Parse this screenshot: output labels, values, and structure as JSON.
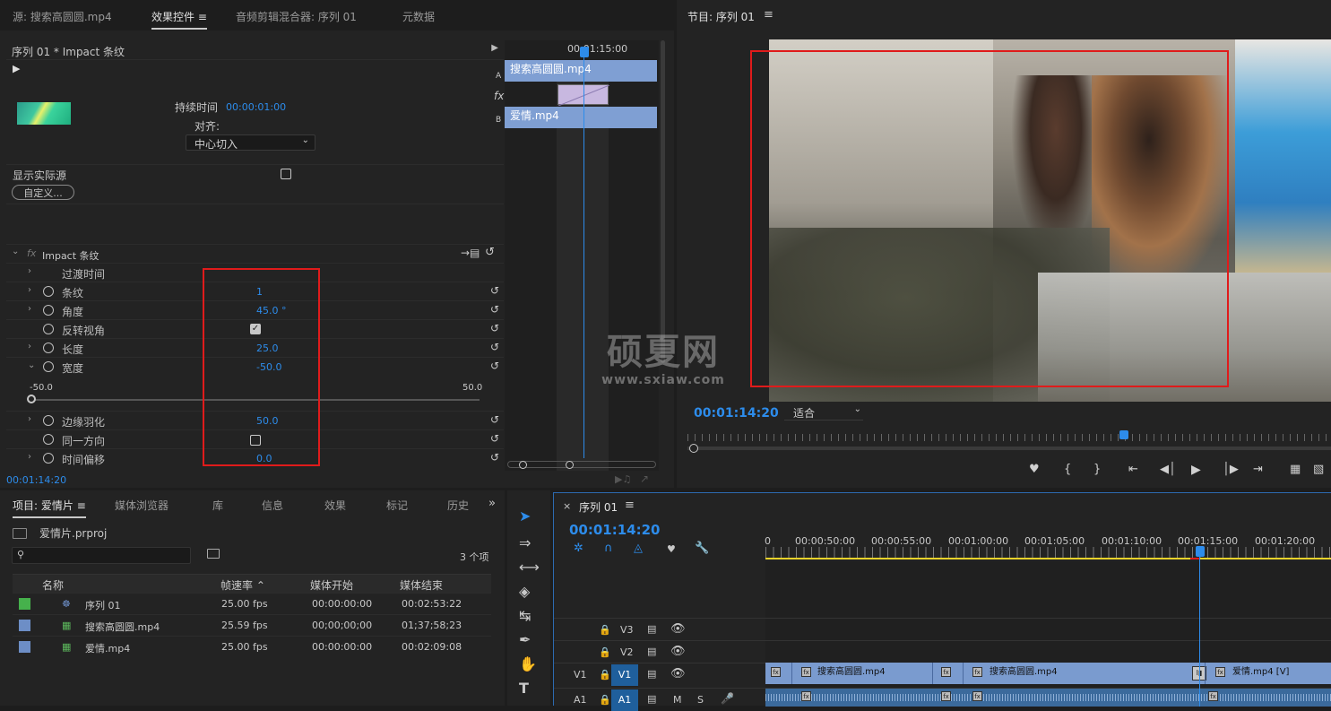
{
  "source_panel": {
    "tabs": [
      "源: 搜索高圆圆.mp4",
      "效果控件",
      "音频剪辑混合器: 序列 01",
      "元数据"
    ],
    "header": "序列 01 * Impact 条纹",
    "duration_label": "持续时间",
    "duration_value": "00:00:01:00",
    "align_label": "对齐:",
    "align_value": "中心切入",
    "show_source_label": "显示实际源",
    "custom_button": "自定义...",
    "effect_name": "Impact 条纹",
    "transition_time_label": "过渡时间",
    "params": [
      {
        "label": "条纹",
        "value": "1"
      },
      {
        "label": "角度",
        "value": "45.0 °"
      },
      {
        "label": "反转视角",
        "value": ""
      },
      {
        "label": "长度",
        "value": "25.0"
      },
      {
        "label": "宽度",
        "value": "-50.0"
      },
      {
        "label": "边缘羽化",
        "value": "50.0"
      },
      {
        "label": "同一方向",
        "value": ""
      },
      {
        "label": "时间偏移",
        "value": "0.0"
      }
    ],
    "slider_min": "-50.0",
    "slider_max": "50.0",
    "timecode": "00:01:14:20",
    "mini_timeline": {
      "time": "00:01:15:00",
      "clip_a": "搜索高圆圆.mp4",
      "clip_b": "爱情.mp4",
      "label_a": "A",
      "label_b": "B",
      "fx": "fx"
    }
  },
  "program_panel": {
    "title": "节目: 序列 01",
    "timecode": "00:01:14:20",
    "fit": "适合",
    "watermark_main": "硕夏网",
    "watermark_url": "www.sxiaw.com"
  },
  "project_panel": {
    "tabs": [
      "项目: 爱情片",
      "媒体浏览器",
      "库",
      "信息",
      "效果",
      "标记",
      "历史"
    ],
    "project_file": "爱情片.prproj",
    "item_count": "3 个项",
    "columns": [
      "名称",
      "帧速率",
      "媒体开始",
      "媒体结束"
    ],
    "rows": [
      {
        "name": "序列 01",
        "fps": "25.00 fps",
        "start": "00:00:00:00",
        "end": "00:02:53:22",
        "color": "#46b14c"
      },
      {
        "name": "搜索高圆圆.mp4",
        "fps": "25.59 fps",
        "start": "00;00;00;00",
        "end": "01;37;58;23",
        "color": "#6d8ec6"
      },
      {
        "name": "爱情.mp4",
        "fps": "25.00 fps",
        "start": "00:00:00:00",
        "end": "00:02:09:08",
        "color": "#6d8ec6"
      }
    ]
  },
  "timeline_panel": {
    "title": "序列 01",
    "timecode": "00:01:14:20",
    "ruler": [
      "0",
      "00:00:50:00",
      "00:00:55:00",
      "00:01:00:00",
      "00:01:05:00",
      "00:01:10:00",
      "00:01:15:00",
      "00:01:20:00"
    ],
    "tracks": {
      "v3": "V3",
      "v2": "V2",
      "v1": "V1",
      "a1": "A1",
      "m": "M",
      "s": "S"
    },
    "clips": [
      "搜索高圆圆.mp4",
      "搜索高圆圆.mp4",
      "爱情.mp4 [V]"
    ],
    "fx_badge": "fx"
  }
}
